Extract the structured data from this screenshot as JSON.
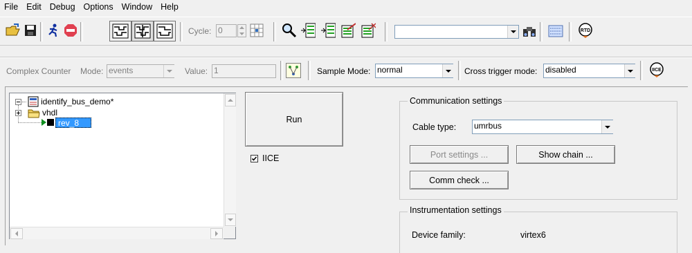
{
  "menu": [
    "File",
    "Edit",
    "Debug",
    "Options",
    "Window",
    "Help"
  ],
  "toolbar": {
    "cycle_label": "Cycle:",
    "cycle_value": "0",
    "search_value": "",
    "rtd_label": "RTD",
    "iice_label": "IICE"
  },
  "toolbar2": {
    "counter_label": "Complex Counter",
    "mode_label": "Mode:",
    "mode_value": "events",
    "value_label": "Value:",
    "value_value": "1",
    "sample_mode_label": "Sample Mode:",
    "sample_mode_value": "normal",
    "cross_trigger_label": "Cross trigger mode:",
    "cross_trigger_value": "disabled"
  },
  "tree": {
    "root": "identify_bus_demo*",
    "child": "vhdl",
    "selected": "rev_8"
  },
  "run_label": "Run",
  "iice_checkbox": "IICE",
  "communication": {
    "title": "Communication settings",
    "cable_label": "Cable type:",
    "cable_value": "umrbus",
    "port_settings": "Port settings ...",
    "show_chain": "Show chain ...",
    "comm_check": "Comm check ..."
  },
  "instrumentation": {
    "title": "Instrumentation settings",
    "device_family_label": "Device family:",
    "device_family_value": "virtex6"
  }
}
